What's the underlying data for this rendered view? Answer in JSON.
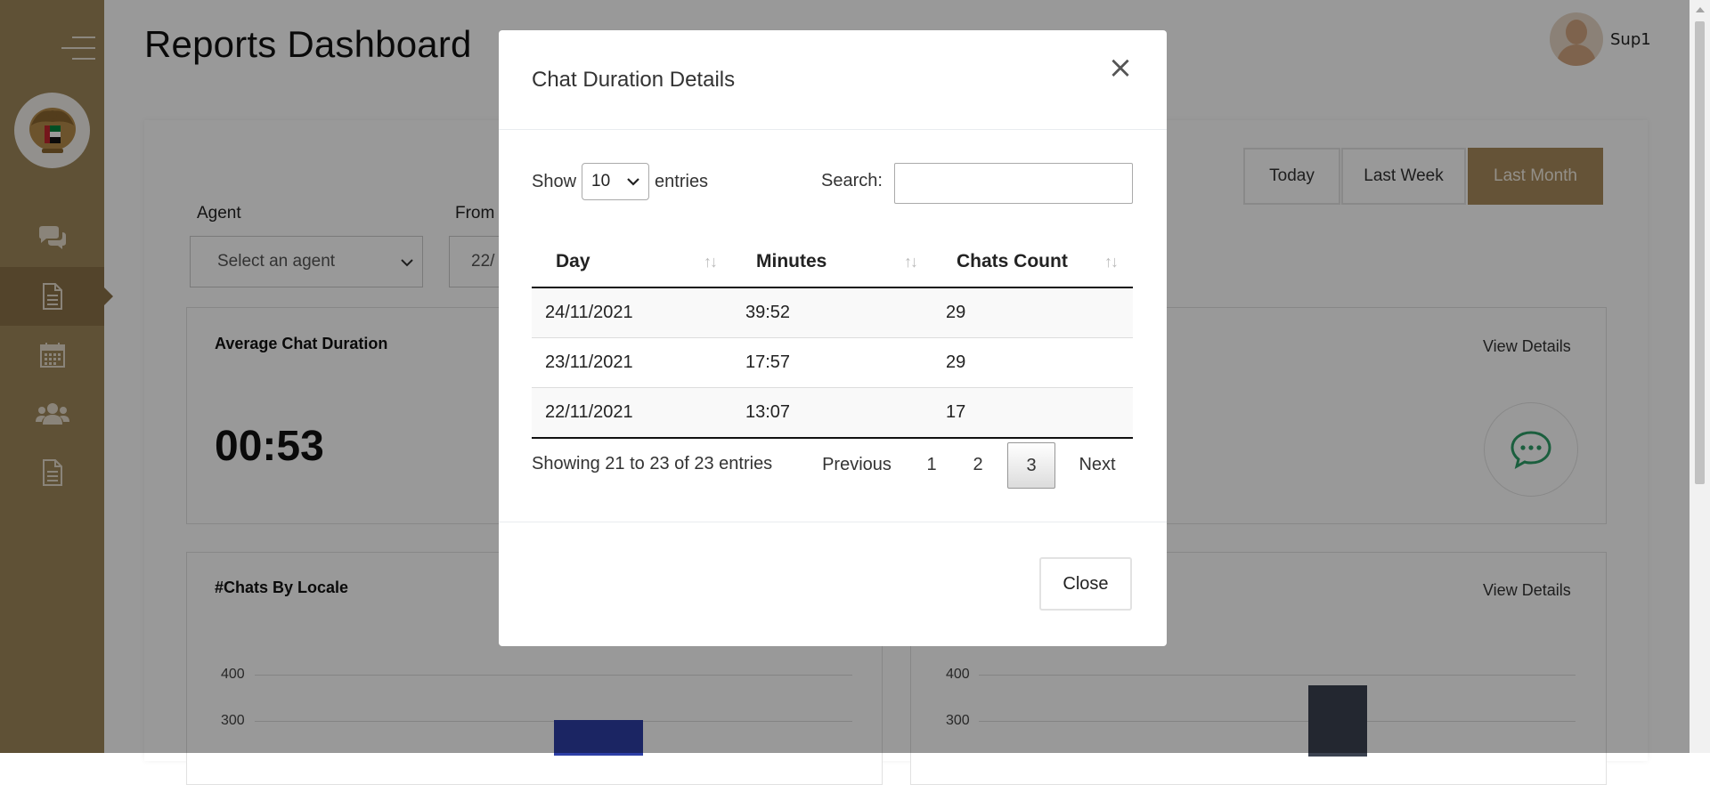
{
  "page": {
    "title": "Reports Dashboard"
  },
  "user": {
    "name": "Sup1"
  },
  "sidebar": {
    "items": [
      {
        "icon": "chat-bubbles-icon"
      },
      {
        "icon": "report-document-icon",
        "active": true
      },
      {
        "icon": "calendar-icon"
      },
      {
        "icon": "users-icon"
      },
      {
        "icon": "document-list-icon"
      }
    ]
  },
  "filters": {
    "ranges": [
      "Today",
      "Last Week",
      "Last Month"
    ],
    "active_range": "Last Month",
    "agent_label": "Agent",
    "agent_placeholder": "Select an agent",
    "from_label": "From",
    "from_value": "22/"
  },
  "cards": {
    "avg_duration": {
      "title": "Average Chat Duration",
      "value": "00:53"
    },
    "right_top": {
      "view_details": "View Details"
    },
    "chats_by_locale": {
      "title": "#Chats By Locale",
      "y_ticks": [
        "400",
        "300"
      ]
    },
    "right_bottom": {
      "view_details": "View Details",
      "y_ticks": [
        "400",
        "300"
      ]
    }
  },
  "modal": {
    "title": "Chat Duration Details",
    "show_label": "Show",
    "entries_value": "10",
    "entries_label": "entries",
    "search_label": "Search:",
    "search_value": "",
    "columns": [
      "Day",
      "Minutes",
      "Chats Count"
    ],
    "rows": [
      {
        "day": "24/11/2021",
        "minutes": "39:52",
        "count": "29"
      },
      {
        "day": "23/11/2021",
        "minutes": "17:57",
        "count": "29"
      },
      {
        "day": "22/11/2021",
        "minutes": "13:07",
        "count": "17"
      }
    ],
    "info": "Showing 21 to 23 of 23 entries",
    "pagination": {
      "previous": "Previous",
      "pages": [
        "1",
        "2",
        "3"
      ],
      "current": "3",
      "next": "Next"
    },
    "close_label": "Close"
  },
  "colors": {
    "sidebar": "#9f875a",
    "accent": "#a88b5c",
    "chat_icon": "#2e9e68",
    "bar_left": "#2d3fa6",
    "bar_right": "#3b4250"
  }
}
